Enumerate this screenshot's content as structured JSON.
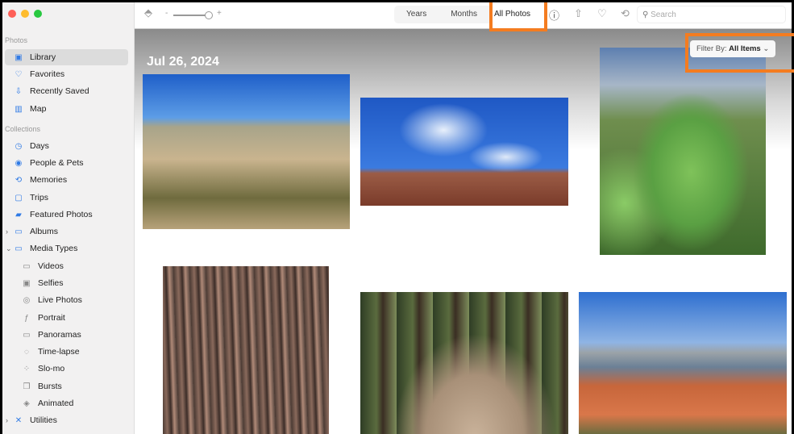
{
  "sidebar": {
    "sections": {
      "photos": "Photos",
      "collections": "Collections"
    },
    "items": [
      {
        "label": "Library",
        "icon": "library-icon",
        "glyph": "▣"
      },
      {
        "label": "Favorites",
        "icon": "heart-icon",
        "glyph": "♡"
      },
      {
        "label": "Recently Saved",
        "icon": "download-icon",
        "glyph": "⇩"
      },
      {
        "label": "Map",
        "icon": "map-icon",
        "glyph": "▥"
      },
      {
        "label": "Days",
        "icon": "clock-icon",
        "glyph": "◷"
      },
      {
        "label": "People & Pets",
        "icon": "person-circle-icon",
        "glyph": "◉"
      },
      {
        "label": "Memories",
        "icon": "memories-icon",
        "glyph": "⟲"
      },
      {
        "label": "Trips",
        "icon": "suitcase-icon",
        "glyph": "▢"
      },
      {
        "label": "Featured Photos",
        "icon": "photo-icon",
        "glyph": "▰"
      },
      {
        "label": "Albums",
        "icon": "folder-icon",
        "glyph": "▭"
      },
      {
        "label": "Media Types",
        "icon": "folder-icon",
        "glyph": "▭"
      },
      {
        "label": "Videos",
        "icon": "video-icon",
        "glyph": "▭"
      },
      {
        "label": "Selfies",
        "icon": "selfie-icon",
        "glyph": "▣"
      },
      {
        "label": "Live Photos",
        "icon": "live-photo-icon",
        "glyph": "◎"
      },
      {
        "label": "Portrait",
        "icon": "portrait-icon",
        "glyph": "ƒ"
      },
      {
        "label": "Panoramas",
        "icon": "panorama-icon",
        "glyph": "▭"
      },
      {
        "label": "Time-lapse",
        "icon": "timelapse-icon",
        "glyph": "◌"
      },
      {
        "label": "Slo-mo",
        "icon": "slomo-icon",
        "glyph": "⁘"
      },
      {
        "label": "Bursts",
        "icon": "bursts-icon",
        "glyph": "❒"
      },
      {
        "label": "Animated",
        "icon": "animated-icon",
        "glyph": "◈"
      },
      {
        "label": "Utilities",
        "icon": "tools-icon",
        "glyph": "✕"
      }
    ]
  },
  "toolbar": {
    "tabs": [
      "Years",
      "Months",
      "All Photos"
    ],
    "active_tab": "All Photos",
    "zoom_minus": "-",
    "zoom_plus": "+",
    "search_placeholder": "Search"
  },
  "content": {
    "date": "Jul 26, 2024",
    "filter_label": "Filter By:",
    "filter_value": "All Items"
  },
  "highlight_color": "#f47c20"
}
